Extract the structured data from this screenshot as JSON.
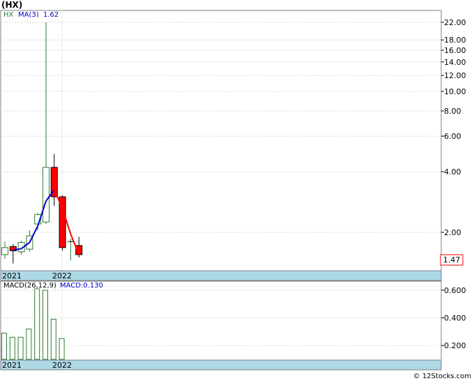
{
  "ticker_label": "(HX)",
  "footer_text": "© 12Stocks.com",
  "colors": {
    "up_candle_border": "#2e7d32",
    "down_candle_fill": "#ff0000",
    "ma_up": "#0000cc",
    "ma_down": "#ff0000",
    "macd_bar": "#2e7d32",
    "date_strip": "#add8e6",
    "grid": "#c0c0c0",
    "price_box_border": "#ff0000"
  },
  "chart_data": [
    {
      "type": "candlestick",
      "legend": {
        "symbol": "HX",
        "ma_label": "MA(3)",
        "ma_value": "1.62"
      },
      "y_scale": "log",
      "ylim": [
        1.3,
        25
      ],
      "y_ticks": [
        {
          "value": 22,
          "label": "22.00"
        },
        {
          "value": 18,
          "label": "18.00"
        },
        {
          "value": 16,
          "label": "16.00"
        },
        {
          "value": 14,
          "label": "14.00"
        },
        {
          "value": 12,
          "label": "12.00"
        },
        {
          "value": 10,
          "label": "10.00"
        },
        {
          "value": 8,
          "label": "8.00"
        },
        {
          "value": 6,
          "label": "6.00"
        },
        {
          "value": 4,
          "label": "4.00"
        },
        {
          "value": 2,
          "label": "2.00"
        }
      ],
      "last_price": "1.47",
      "x_labels": [
        "2021",
        "2022"
      ],
      "candles": [
        {
          "open": 1.55,
          "close": 1.68,
          "high": 1.8,
          "low": 1.48
        },
        {
          "open": 1.7,
          "close": 1.62,
          "high": 1.75,
          "low": 1.4
        },
        {
          "open": 1.6,
          "close": 1.78,
          "high": 1.82,
          "low": 1.55
        },
        {
          "open": 1.65,
          "close": 1.92,
          "high": 2.05,
          "low": 1.6
        },
        {
          "open": 2.2,
          "close": 2.45,
          "high": 2.5,
          "low": 2.05
        },
        {
          "open": 2.25,
          "close": 4.2,
          "high": 22.0,
          "low": 2.2
        },
        {
          "open": 4.2,
          "close": 3.0,
          "high": 4.9,
          "low": 2.7
        },
        {
          "open": 3.0,
          "close": 1.68,
          "high": 3.05,
          "low": 1.62
        },
        {
          "open": 1.8,
          "close": 1.8,
          "high": 1.86,
          "low": 1.45
        },
        {
          "open": 1.72,
          "close": 1.55,
          "high": 1.9,
          "low": 1.5
        }
      ],
      "ma": [
        null,
        1.63,
        1.66,
        1.78,
        2.15,
        2.86,
        3.25,
        2.62,
        1.96,
        1.55
      ]
    },
    {
      "type": "bar",
      "legend": {
        "label": "MACD(26,12,9)",
        "value_label": "MACD:0.130"
      },
      "ylim": [
        0.1,
        0.66
      ],
      "y_ticks": [
        {
          "value": 0.6,
          "label": "0.600"
        },
        {
          "value": 0.4,
          "label": "0.400"
        },
        {
          "value": 0.2,
          "label": "0.200"
        }
      ],
      "x_labels": [
        "2021",
        "2022"
      ],
      "values": [
        0.29,
        0.26,
        0.26,
        0.32,
        0.61,
        0.6,
        0.39,
        0.25
      ]
    }
  ]
}
